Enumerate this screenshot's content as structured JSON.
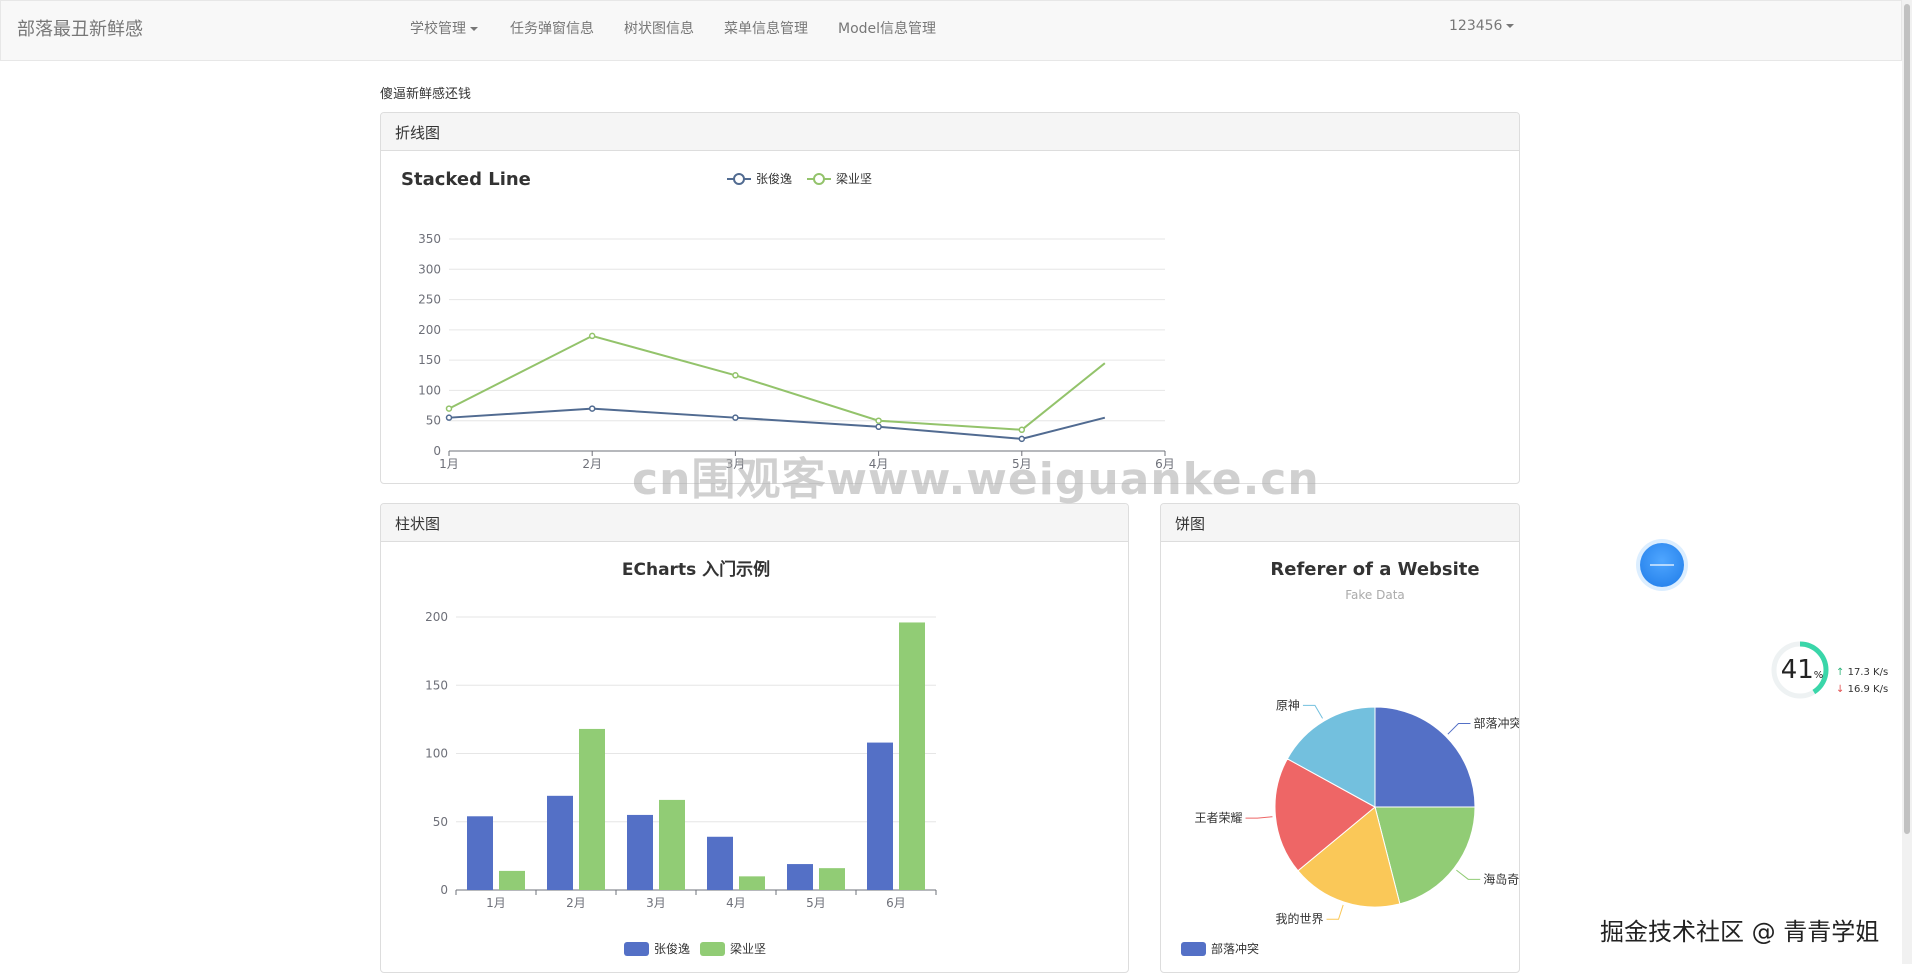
{
  "navbar": {
    "brand": "部落最丑新鲜感",
    "items": [
      {
        "label": "学校管理",
        "dropdown": true
      },
      {
        "label": "任务弹窗信息"
      },
      {
        "label": "树状图信息"
      },
      {
        "label": "菜单信息管理"
      },
      {
        "label": "Model信息管理"
      }
    ],
    "user": "123456"
  },
  "page_subtitle": "傻逼新鲜感还钱",
  "panels": {
    "line": {
      "heading": "折线图"
    },
    "bar": {
      "heading": "柱状图"
    },
    "pie": {
      "heading": "饼图"
    }
  },
  "colors": {
    "blue": "#5470c6",
    "green": "#91cc75",
    "yellow": "#fac858",
    "red": "#ee6666",
    "cyan": "#73c0de",
    "line_blue": "#516b91",
    "line_green": "#93c36b"
  },
  "chart_data": [
    {
      "type": "line",
      "title": "Stacked Line",
      "categories": [
        "1月",
        "2月",
        "3月",
        "4月",
        "5月",
        "6月"
      ],
      "series": [
        {
          "name": "张俊逸",
          "values": [
            55,
            70,
            55,
            40,
            20,
            55
          ]
        },
        {
          "name": "梁业坚",
          "values": [
            70,
            190,
            125,
            50,
            35,
            145
          ]
        }
      ],
      "ylim": [
        0,
        350
      ],
      "yticks": [
        0,
        50,
        100,
        150,
        200,
        250,
        300,
        350
      ],
      "legend": "top-center",
      "toolbox": "save-as-image"
    },
    {
      "type": "bar",
      "title": "ECharts 入门示例",
      "categories": [
        "1月",
        "2月",
        "3月",
        "4月",
        "5月",
        "6月"
      ],
      "series": [
        {
          "name": "张俊逸",
          "values": [
            54,
            69,
            55,
            39,
            19,
            108
          ]
        },
        {
          "name": "梁业坚",
          "values": [
            14,
            118,
            66,
            10,
            16,
            196
          ]
        }
      ],
      "ylim": [
        0,
        200
      ],
      "yticks": [
        0,
        50,
        100,
        150,
        200
      ],
      "legend": "bottom-center"
    },
    {
      "type": "pie",
      "title": "Referer of a Website",
      "subtitle": "Fake Data",
      "slices": [
        {
          "name": "部落冲突",
          "value": 25
        },
        {
          "name": "海岛奇兵",
          "value": 21
        },
        {
          "name": "我的世界",
          "value": 18
        },
        {
          "name": "王者荣耀",
          "value": 19
        },
        {
          "name": "原神",
          "value": 17
        }
      ],
      "legend_visible": [
        "部落冲突"
      ]
    }
  ],
  "watermark": "cn围观客www.weiguanke.cn",
  "corner_watermark": "掘金技术社区 @ 青青学姐",
  "speed_widget": {
    "percent": "41",
    "unit": "%",
    "upload": "17.3 K/s",
    "download": "16.9 K/s"
  }
}
